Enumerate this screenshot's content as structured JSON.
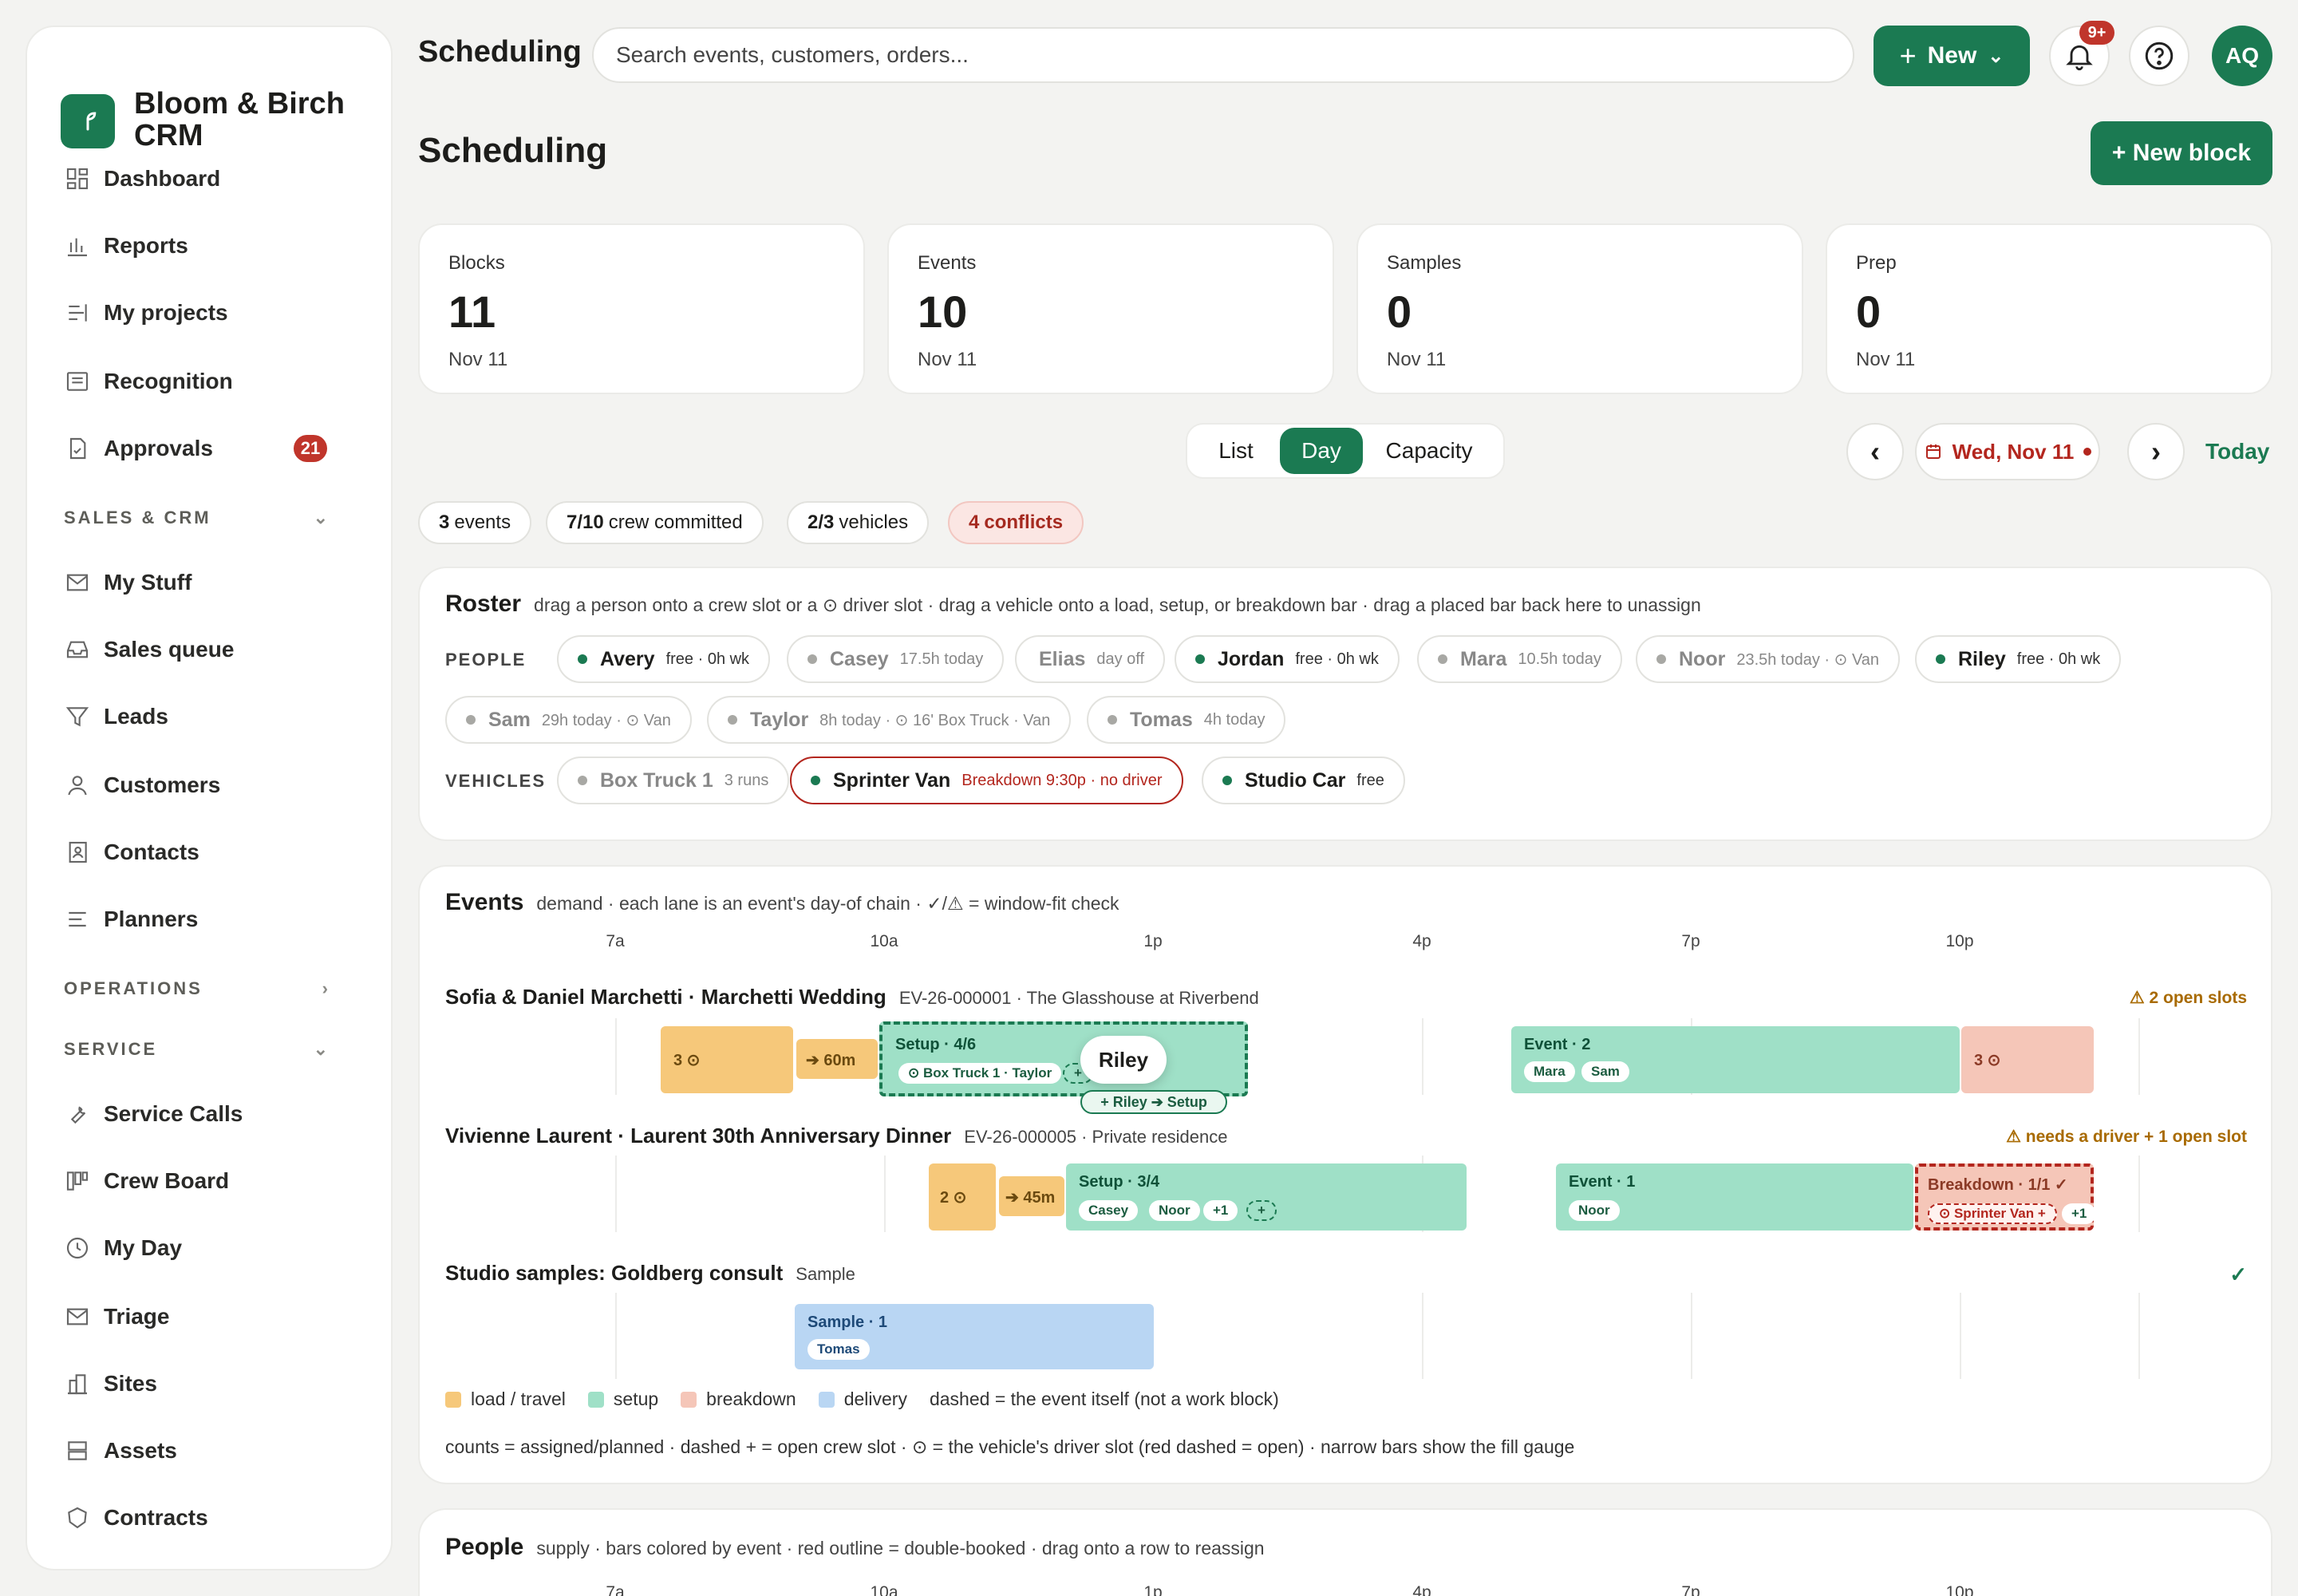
{
  "app": {
    "brand": "Bloom & Birch CRM"
  },
  "sidebar": {
    "items": [
      {
        "label": "Dashboard"
      },
      {
        "label": "Reports"
      },
      {
        "label": "My projects"
      },
      {
        "label": "Recognition"
      },
      {
        "label": "Approvals",
        "badge": "21"
      }
    ],
    "sections": [
      {
        "label": "SALES & CRM",
        "items": [
          "My Stuff",
          "Sales queue",
          "Leads",
          "Customers",
          "Contacts",
          "Planners"
        ]
      },
      {
        "label": "OPERATIONS"
      },
      {
        "label": "SERVICE",
        "items": [
          "Service Calls",
          "Crew Board",
          "My Day",
          "Triage",
          "Sites",
          "Assets",
          "Contracts"
        ]
      }
    ]
  },
  "topbar": {
    "title": "Scheduling",
    "search_placeholder": "Search events, customers, orders...",
    "new_label": "New",
    "notif_badge": "9+",
    "avatar": "AQ"
  },
  "page": {
    "title": "Scheduling",
    "new_block": "+ New block"
  },
  "stats": [
    {
      "label": "Blocks",
      "value": "11",
      "sub": "Nov 11"
    },
    {
      "label": "Events",
      "value": "10",
      "sub": "Nov 11"
    },
    {
      "label": "Samples",
      "value": "0",
      "sub": "Nov 11"
    },
    {
      "label": "Prep",
      "value": "0",
      "sub": "Nov 11"
    }
  ],
  "views": [
    "List",
    "Day",
    "Capacity"
  ],
  "active_view": "Day",
  "date": {
    "label": "Wed, Nov 11",
    "today": "Today"
  },
  "chips": [
    {
      "bold": "3",
      "text": "events"
    },
    {
      "bold": "7/10",
      "text": "crew committed"
    },
    {
      "bold": "2/3",
      "text": "vehicles"
    },
    {
      "bold": "4",
      "text": "conflicts"
    }
  ],
  "roster": {
    "title": "Roster",
    "desc": "drag a person onto a crew slot or a ⊙ driver slot · drag a vehicle onto a load, setup, or breakdown bar · drag a placed bar back here to unassign",
    "people_label": "PEOPLE",
    "vehicles_label": "VEHICLES",
    "people": [
      {
        "name": "Avery",
        "note": "free · 0h wk"
      },
      {
        "name": "Casey",
        "note": "17.5h today"
      },
      {
        "name": "Elias",
        "note": "day off"
      },
      {
        "name": "Jordan",
        "note": "free · 0h wk"
      },
      {
        "name": "Mara",
        "note": "10.5h today"
      },
      {
        "name": "Noor",
        "note": "23.5h today · ⊙ Van"
      },
      {
        "name": "Riley",
        "note": "free · 0h wk"
      },
      {
        "name": "Sam",
        "note": "29h today · ⊙ Van"
      },
      {
        "name": "Taylor",
        "note": "8h today · ⊙ 16' Box Truck · Van"
      },
      {
        "name": "Tomas",
        "note": "4h today"
      }
    ],
    "vehicles": [
      {
        "name": "Box Truck 1",
        "note": "3 runs"
      },
      {
        "name": "Sprinter Van",
        "note": "Breakdown 9:30p · no driver"
      },
      {
        "name": "Studio Car",
        "note": "free"
      }
    ]
  },
  "events": {
    "title": "Events",
    "desc": "demand · each lane is an event's day-of chain · ✓/⚠ = window-fit check",
    "hours": [
      "7a",
      "10a",
      "1p",
      "4p",
      "7p",
      "10p"
    ],
    "lanes": [
      {
        "name": "Sofia & Daniel Marchetti · Marchetti Wedding",
        "meta": "EV-26-000001 · The Glasshouse at Riverbend",
        "flag": "⚠ 2 open slots",
        "load": "3 ⊙",
        "travel": "➔ 60m",
        "setup": "Setup · 4/6",
        "setup_tags": [
          "⊙ Box Truck 1 · Taylor",
          "+"
        ],
        "drag_ghost": "Riley",
        "drop_hint": "+ Riley ➔ Setup",
        "event": "Event · 2",
        "event_tags": [
          "Mara",
          "Sam"
        ],
        "breakdown": "3 ⊙"
      },
      {
        "name": "Vivienne Laurent · Laurent 30th Anniversary Dinner",
        "meta": "EV-26-000005 · Private residence",
        "flag": "⚠ needs a driver + 1 open slot",
        "load": "2 ⊙",
        "travel": "➔ 45m",
        "setup": "Setup · 3/4",
        "setup_tags": [
          "Casey",
          "Noor",
          "+1",
          "+"
        ],
        "event": "Event · 1",
        "event_tags": [
          "Noor"
        ],
        "breakdown": "Breakdown · 1/1 ✓",
        "breakdown_tags": [
          "⊙ Sprinter Van +",
          "+1"
        ]
      },
      {
        "name": "Studio samples: Goldberg consult",
        "meta": "Sample",
        "flag": "✓",
        "delivery": "Sample · 1",
        "delivery_tags": [
          "Tomas"
        ]
      }
    ],
    "legend": [
      "load / travel",
      "setup",
      "breakdown",
      "delivery",
      "dashed = the event itself (not a work block)"
    ],
    "footnote": "counts = assigned/planned · dashed + = open crew slot · ⊙ = the vehicle's driver slot (red dashed = open) · narrow bars show the fill gauge"
  },
  "people_panel": {
    "title": "People",
    "desc": "supply · bars colored by event · red outline = double-booked · drag onto a row to reassign"
  },
  "colors": {
    "accent": "#1b7a52",
    "danger": "#c0352b"
  }
}
